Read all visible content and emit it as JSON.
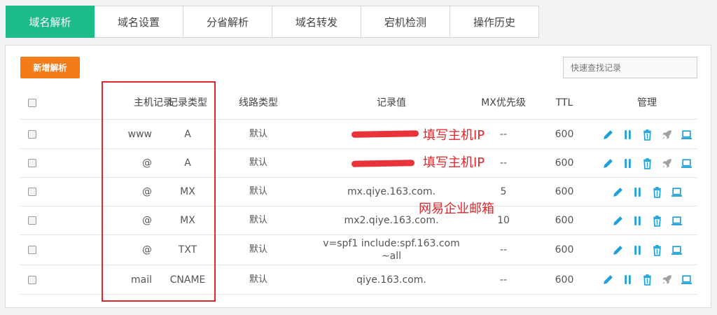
{
  "tabs": [
    {
      "label": "域名解析",
      "active": true
    },
    {
      "label": "域名设置",
      "active": false
    },
    {
      "label": "分省解析",
      "active": false
    },
    {
      "label": "域名转发",
      "active": false
    },
    {
      "label": "宕机检测",
      "active": false
    },
    {
      "label": "操作历史",
      "active": false
    }
  ],
  "toolbar": {
    "add_label": "新增解析",
    "search_placeholder": "快速查找记录"
  },
  "table": {
    "headers": {
      "host": "主机记录",
      "type": "记录类型",
      "line": "线路类型",
      "value": "记录值",
      "mx": "MX优先级",
      "ttl": "TTL",
      "manage": "管理"
    },
    "rows": [
      {
        "host": "www",
        "type": "A",
        "line": "默认",
        "value": "",
        "mx": "--",
        "ttl": "600"
      },
      {
        "host": "@",
        "type": "A",
        "line": "默认",
        "value": "",
        "mx": "--",
        "ttl": "600"
      },
      {
        "host": "@",
        "type": "MX",
        "line": "默认",
        "value": "mx.qiye.163.com.",
        "mx": "5",
        "ttl": "600"
      },
      {
        "host": "@",
        "type": "MX",
        "line": "默认",
        "value": "mx2.qiye.163.com.",
        "mx": "10",
        "ttl": "600"
      },
      {
        "host": "@",
        "type": "TXT",
        "line": "默认",
        "value": "v=spf1 include:spf.163.com ~all",
        "mx": "--",
        "ttl": "600"
      },
      {
        "host": "mail",
        "type": "CNAME",
        "line": "默认",
        "value": "qiye.163.com.",
        "mx": "--",
        "ttl": "600"
      }
    ]
  },
  "annotations": {
    "fill_ip_1": "填写主机IP",
    "fill_ip_2": "填写主机IP",
    "netease_mail": "网易企业邮箱"
  },
  "colors": {
    "accent": "#1cbb8a",
    "add_button": "#f47c18",
    "icon": "#1ea1d8",
    "icon_disabled": "#a0a0a0",
    "annotation": "#e0262b"
  }
}
